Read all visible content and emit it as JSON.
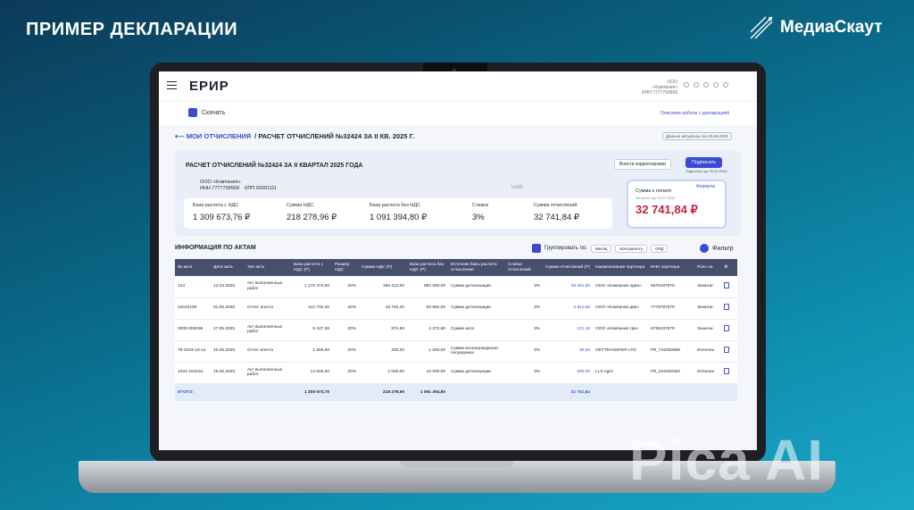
{
  "slide": {
    "title": "ПРИМЕР ДЕКЛАРАЦИИ",
    "brand": "МедиаСкаут",
    "watermark": "Pica AI"
  },
  "app": {
    "logo": "ЕРИР",
    "org_name": "ООО «Компания»",
    "org_inn": "ИНН 7777799999",
    "download_label": "Скачать",
    "help_link": "Описание работы с декларацией",
    "breadcrumb_root": "МОИ ОТЧИСЛЕНИЯ",
    "breadcrumb_current": "/ РАСЧЕТ ОТЧИСЛЕНИЙ №32424 ЗА II КВ. 2025 Г.",
    "updated_badge": "Данные актуальны на 20.06.2025"
  },
  "summary": {
    "title": "РАСЧЕТ ОТЧИСЛЕНИЙ №32424 ЗА II КВАРТАЛ 2025 ГОДА",
    "correction_button": "Внести корректировки",
    "sign_button": "Подписать",
    "sign_date": "Подписать до 25.06.2025",
    "company_name": "ООО «Компания»",
    "company_inn": "ИНН 7777799999",
    "company_kpp": "КПП 00001111",
    "uuid_label": "UUID:",
    "metrics": [
      {
        "label": "База расчета с НДС",
        "value": "1 309 673,76 ₽"
      },
      {
        "label": "Сумма НДС",
        "value": "218 278,96 ₽"
      },
      {
        "label": "База расчета без НДС",
        "value": "1 091 394,80 ₽"
      },
      {
        "label": "Ставка",
        "value": "3%"
      },
      {
        "label": "Сумма отчислений",
        "value": "32 741,84 ₽"
      }
    ],
    "payment_label": "Сумма к оплате",
    "payment_date": "Оплатить до 25.07.2025",
    "payment_value": "32 741,84 ₽",
    "formula_label": "Формула"
  },
  "acts": {
    "title": "ИНФОРМАЦИЯ ПО АКТАМ",
    "group_label": "Группировать по:",
    "group_chips": [
      "Месяц",
      "Контрагенту",
      "ОРД"
    ],
    "filter_label": "Фильтр",
    "columns": [
      "№ акта",
      "Дата акта",
      "Тип акта",
      "База расчета с НДС (Р)",
      "Размер НДС",
      "Сумма НДС (Р)",
      "База расчета без НДС (Р)",
      "Источник базы расчета отчисления",
      "Ставка отчислений",
      "Сумма отчислений (Р)",
      "Наименование партнера",
      "ИНН партнера",
      "Роль па"
    ],
    "rows": [
      [
        "124",
        "12.04.2025",
        "Акт выполненных работ",
        "1 178 472,00",
        "20%",
        "196 412,00",
        "982 060,00",
        "Сумма детализации",
        "3%",
        "29 461,80",
        "ООО «Компания один»",
        "5976197879",
        "Заказчи"
      ],
      [
        "24010100",
        "01.05.2025",
        "Отчет агента",
        "112 734,40",
        "20%",
        "18 792,40",
        "93 862,00",
        "Сумма детализации",
        "3%",
        "2 811,86",
        "ООО «Компания два»",
        "7779797879",
        "Заказчи"
      ],
      [
        "0000-000038",
        "17.05.2025",
        "Акт выполненных работ",
        "5 247,36",
        "20%",
        "874,56",
        "4 372,80",
        "Сумма акта",
        "3%",
        "131,18",
        "ООО «Компания три»",
        "5796197879",
        "Заказчи"
      ],
      [
        "75-2023-10-14",
        "10.06.2025",
        "Отчет агента",
        "1 200,00",
        "20%",
        "200,00",
        "1 000,00",
        "Сумма вознаграждения посредника",
        "3%",
        "30,00",
        "GETTRANSFER LTD",
        "FR_742002855",
        "Исполни"
      ],
      [
        "1022-163164",
        "15.06.2025",
        "Акт выполненных работ",
        "12 000,00",
        "20%",
        "2 000,00",
        "10 000,00",
        "Сумма детализации",
        "3%",
        "300,00",
        "LLS Agro",
        "FR_942002852",
        "Исполни"
      ]
    ],
    "total_label": "ИТОГО:",
    "totals": {
      "base_vat": "1 309 673,76",
      "vat": "218 278,96",
      "base_novat": "1 091 394,80",
      "deduction": "32 741,84"
    }
  }
}
